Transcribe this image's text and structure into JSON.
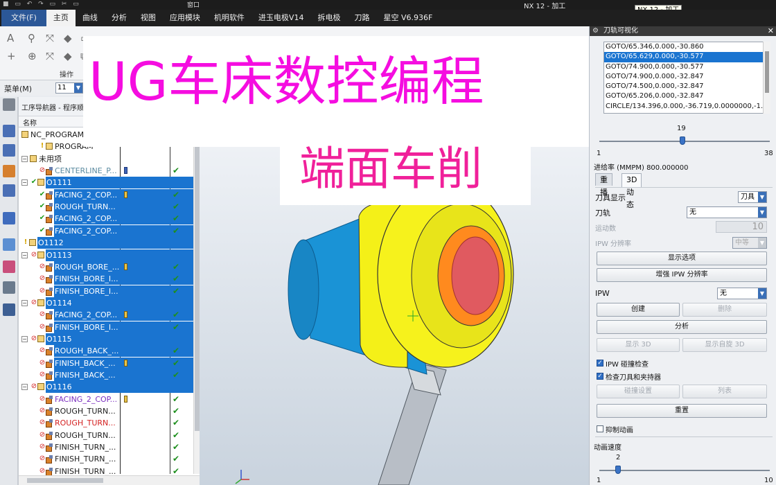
{
  "app": {
    "title": "NX 12 - 加工",
    "window_menu": "窗口",
    "tooltip": "NX 12 - 加工"
  },
  "menubar": [
    "文件(F)",
    "主页",
    "曲线",
    "分析",
    "视图",
    "应用模块",
    "机明软件",
    "进玉电极V14",
    "拆电极",
    "刀路",
    "星空 V6.936F"
  ],
  "ribbon": {
    "group_label": "操作"
  },
  "toolbar2": {
    "menu_label": "菜单(M)",
    "combo_value": "11"
  },
  "navigator": {
    "title": "工序导航器 - 程序顺序",
    "column_name": "名称",
    "rows": [
      {
        "label": "NC_PROGRAM"
      },
      {
        "label": "PROGRAM"
      },
      {
        "label": "未用项"
      },
      {
        "label": "CENTERLINE_P..."
      },
      {
        "label": "O1111"
      },
      {
        "label": "FACING_2_COP..."
      },
      {
        "label": "ROUGH_TURN..."
      },
      {
        "label": "FACING_2_COP..."
      },
      {
        "label": "FACING_2_COP..."
      },
      {
        "label": "O1112"
      },
      {
        "label": "O1113"
      },
      {
        "label": "ROUGH_BORE_..."
      },
      {
        "label": "FINISH_BORE_I..."
      },
      {
        "label": "FINISH_BORE_I..."
      },
      {
        "label": "O1114"
      },
      {
        "label": "FACING_2_COP..."
      },
      {
        "label": "FINISH_BORE_I..."
      },
      {
        "label": "O1115"
      },
      {
        "label": "ROUGH_BACK_..."
      },
      {
        "label": "FINISH_BACK_..."
      },
      {
        "label": "FINISH_BACK_..."
      },
      {
        "label": "O1116"
      },
      {
        "label": "FACING_2_COP..."
      },
      {
        "label": "ROUGH_TURN..."
      },
      {
        "label": "ROUGH_TURN..."
      },
      {
        "label": "ROUGH_TURN..."
      },
      {
        "label": "FINISH_TURN_..."
      },
      {
        "label": "FINISH_TURN_..."
      },
      {
        "label": "FINISH_TURN_..."
      }
    ]
  },
  "overlay": {
    "title": "UG车床数控编程",
    "subtitle": "端面车削"
  },
  "panel": {
    "title": "刀轨可视化",
    "list": [
      "GOTO/65.346,0.000,-30.860",
      "GOTO/65.629,0.000,-30.577",
      "GOTO/74.900,0.000,-30.577",
      "GOTO/74.900,0.000,-32.847",
      "GOTO/74.500,0.000,-32.847",
      "GOTO/65.206,0.000,-32.847",
      "CIRCLE/134.396,0.000,-36.719,0.0000000,-1.00"
    ],
    "slider1": {
      "value": "19",
      "min": "1",
      "max": "38",
      "fraction": 0.486
    },
    "feed_rate": "进给率 (MMPM) 800.000000",
    "tabs": [
      "重播",
      "3D 动态"
    ],
    "tool_display_label": "刀具显示",
    "tool_display_value": "刀具",
    "toolpath_label": "刀轨",
    "toolpath_value": "无",
    "motion_count_label": "运动数",
    "motion_count_value": "10",
    "ipw_res_label": "IPW 分辨率",
    "ipw_res_value": "中等",
    "btn_display_options": "显示选项",
    "btn_enhance_ipw": "增强 IPW 分辨率",
    "ipw_label": "IPW",
    "ipw_value": "无",
    "btn_create": "创建",
    "btn_delete": "删除",
    "btn_analyze": "分析",
    "btn_show3d": "显示 3D",
    "btn_show_auto3d": "显示自旋 3D",
    "chk_ipw_collision": "IPW 碰撞检查",
    "chk_tool_holder": "检查刀具和夹持器",
    "btn_collision_settings": "碰撞设置",
    "btn_list": "列表",
    "btn_reset": "重置",
    "chk_suppress_anim": "抑制动画",
    "anim_speed_label": "动画速度",
    "slider2": {
      "value": "2",
      "min": "1",
      "max": "10",
      "fraction": 0.111
    }
  }
}
